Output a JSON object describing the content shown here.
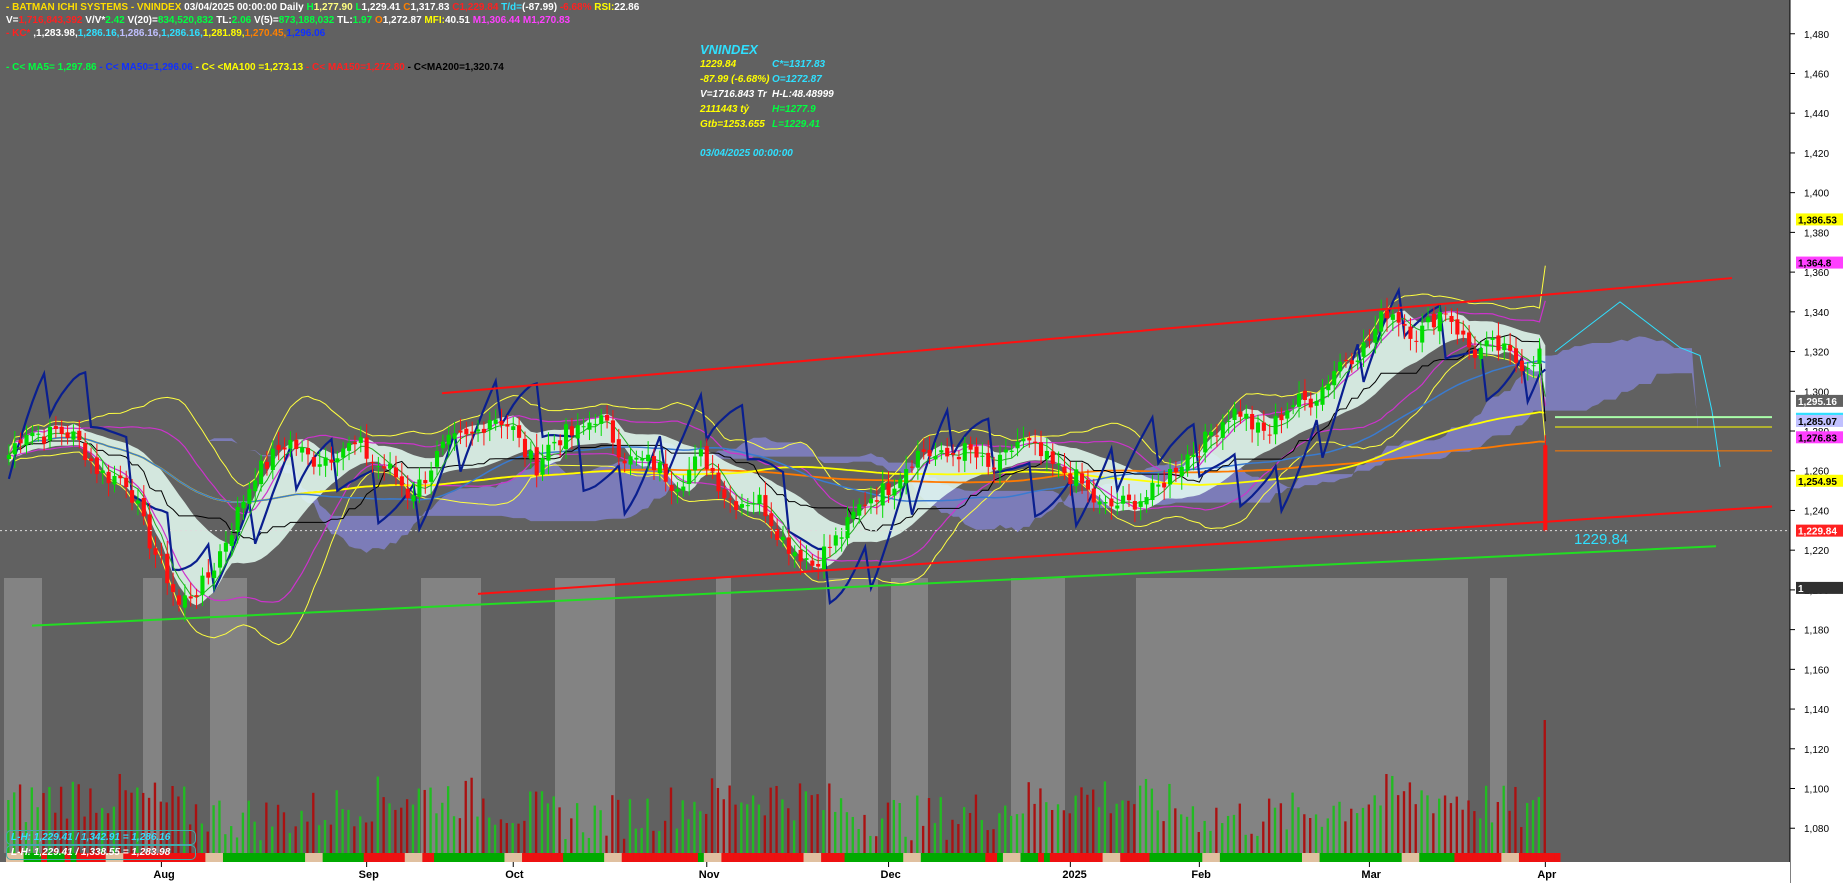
{
  "header": {
    "line1": [
      {
        "t": "- BATMAN  ICHI SYSTEMS - VNINDEX",
        "c": "#ffdd00"
      },
      {
        "t": " 03/04/2025 00:00:00  Daily ",
        "c": "#ffffff"
      },
      {
        "t": "H",
        "c": "#00ff40"
      },
      {
        "t": "1,277.90 ",
        "c": "#ffff80"
      },
      {
        "t": "L",
        "c": "#00ff40"
      },
      {
        "t": "1,229.41 ",
        "c": "#ffffff"
      },
      {
        "t": "C",
        "c": "#ff8000"
      },
      {
        "t": "1,317.83 ",
        "c": "#ffffff"
      },
      {
        "t": "C",
        "c": "#ff2020"
      },
      {
        "t": "1,229.84 ",
        "c": "#ff2020"
      },
      {
        "t": "T/d=",
        "c": "#2fe0ff"
      },
      {
        "t": "(-87.99) ",
        "c": "#ffffff"
      },
      {
        "t": "-6.68% ",
        "c": "#ff2020"
      },
      {
        "t": "RSI:",
        "c": "#ffff00"
      },
      {
        "t": "22.86",
        "c": "#ffffff"
      }
    ],
    "line2": [
      {
        "t": "V=",
        "c": "#ffffff"
      },
      {
        "t": "1,716,843,392 ",
        "c": "#ff2020"
      },
      {
        "t": "V/V*",
        "c": "#ffffff"
      },
      {
        "t": "2.42 ",
        "c": "#00ff40"
      },
      {
        "t": "V(20)=",
        "c": "#ffffff"
      },
      {
        "t": "834,520,832 ",
        "c": "#00ff40"
      },
      {
        "t": "TL:",
        "c": "#ffffff"
      },
      {
        "t": "2.06 ",
        "c": "#00ff40"
      },
      {
        "t": "V(5)=",
        "c": "#ffffff"
      },
      {
        "t": "873,188,032 ",
        "c": "#00ff40"
      },
      {
        "t": "TL:",
        "c": "#ffffff"
      },
      {
        "t": "1.97 ",
        "c": "#00ff40"
      },
      {
        "t": "O",
        "c": "#ff8000"
      },
      {
        "t": "1,272.87 ",
        "c": "#ffffff"
      },
      {
        "t": "MFI:",
        "c": "#ffff00"
      },
      {
        "t": "40.51 ",
        "c": "#ffffff"
      },
      {
        "t": "M",
        "c": "#ff40ff"
      },
      {
        "t": "1,306.44 ",
        "c": "#ff40ff"
      },
      {
        "t": "M",
        "c": "#ff40ff"
      },
      {
        "t": "1,270.83",
        "c": "#ff40ff"
      }
    ],
    "line3": [
      {
        "t": "- KC* ",
        "c": "#ff2020"
      },
      {
        "t": ",1,283.98,",
        "c": "#ffffff"
      },
      {
        "t": "1,286.16,",
        "c": "#2fe0ff"
      },
      {
        "t": "1,286.16,",
        "c": "#c0c0ff"
      },
      {
        "t": "1,286.16,",
        "c": "#2fe0ff"
      },
      {
        "t": "1,281.89,",
        "c": "#ffff00"
      },
      {
        "t": "1,270.45,",
        "c": "#ff8000"
      },
      {
        "t": "1,296.06",
        "c": "#1030ff"
      }
    ],
    "line4": [
      {
        "t": "- C< MA5= 1,297.86 ",
        "c": "#00ff40"
      },
      {
        "t": "- C< MA50=1,296.06 ",
        "c": "#1030ff"
      },
      {
        "t": "- C< <MA100 =1,273.13 ",
        "c": "#ffff00"
      },
      {
        "t": "- C< MA150=1,272.80 ",
        "c": "#ff2020"
      },
      {
        "t": "- C<MA200=1,320.74",
        "c": "#000000"
      }
    ]
  },
  "info": {
    "title": "VNINDEX",
    "rows": [
      [
        {
          "t": "1229.84",
          "c": "#ffff00"
        },
        {
          "t": "C*=1317.83",
          "c": "#2fe0ff"
        }
      ],
      [
        {
          "t": "-87.99 (-6.68%)",
          "c": "#ffff00"
        },
        {
          "t": "O=1272.87",
          "c": "#2fe0ff"
        }
      ],
      [
        {
          "t": "V=1716.843 Tr",
          "c": "#ffffff"
        },
        {
          "t": "H-L:48.48999",
          "c": "#ffffff"
        }
      ],
      [
        {
          "t": "2111443 tỷ",
          "c": "#ffff00"
        },
        {
          "t": "H=1277.9",
          "c": "#00ff40"
        }
      ],
      [
        {
          "t": "Gtb=1253.655",
          "c": "#ffff00"
        },
        {
          "t": "L=1229.41",
          "c": "#00ff40"
        }
      ]
    ],
    "date": "03/04/2025 00:00:00"
  },
  "legend_boxes": [
    {
      "t": "L-H: 1,229.41 / 1,342.91 = 1,286.16",
      "c": "#2fe0ff"
    },
    {
      "t": "L-H: 1,229.41 / 1,338.55 = 1,283.98",
      "c": "#ffffff"
    }
  ],
  "last_price_label": "1229.84",
  "chart_data": {
    "type": "candlestick",
    "title": "VNINDEX",
    "ylim": [
      1063,
      1497
    ],
    "y_ticks": [
      1080,
      1100,
      1120,
      1140,
      1160,
      1180,
      1200,
      1220,
      1240,
      1260,
      1280,
      1300,
      1320,
      1340,
      1360,
      1380,
      1400,
      1420,
      1440,
      1460,
      1480
    ],
    "x_tick_labels": [
      {
        "label": "Aug",
        "i": 26
      },
      {
        "label": "Sep",
        "i": 61
      },
      {
        "label": "Oct",
        "i": 86
      },
      {
        "label": "Nov",
        "i": 119
      },
      {
        "label": "Dec",
        "i": 150
      },
      {
        "label": "2025",
        "i": 181
      },
      {
        "label": "Feb",
        "i": 203
      },
      {
        "label": "Mar",
        "i": 232
      },
      {
        "label": "Apr",
        "i": 262
      }
    ],
    "n_bars": 265,
    "close_anchors": [
      [
        0,
        1268
      ],
      [
        3,
        1278
      ],
      [
        8,
        1282
      ],
      [
        14,
        1266
      ],
      [
        20,
        1252
      ],
      [
        26,
        1215
      ],
      [
        29,
        1189
      ],
      [
        33,
        1205
      ],
      [
        38,
        1228
      ],
      [
        42,
        1262
      ],
      [
        48,
        1272
      ],
      [
        55,
        1266
      ],
      [
        60,
        1275
      ],
      [
        63,
        1262
      ],
      [
        68,
        1250
      ],
      [
        72,
        1262
      ],
      [
        77,
        1277
      ],
      [
        82,
        1285
      ],
      [
        86,
        1282
      ],
      [
        90,
        1262
      ],
      [
        95,
        1280
      ],
      [
        100,
        1285
      ],
      [
        105,
        1270
      ],
      [
        110,
        1260
      ],
      [
        113,
        1256
      ],
      [
        118,
        1265
      ],
      [
        122,
        1250
      ],
      [
        128,
        1242
      ],
      [
        133,
        1225
      ],
      [
        137,
        1210
      ],
      [
        141,
        1228
      ],
      [
        146,
        1242
      ],
      [
        151,
        1258
      ],
      [
        156,
        1268
      ],
      [
        161,
        1270
      ],
      [
        167,
        1262
      ],
      [
        172,
        1272
      ],
      [
        177,
        1268
      ],
      [
        181,
        1255
      ],
      [
        186,
        1245
      ],
      [
        191,
        1240
      ],
      [
        195,
        1252
      ],
      [
        200,
        1262
      ],
      [
        205,
        1282
      ],
      [
        210,
        1288
      ],
      [
        215,
        1280
      ],
      [
        220,
        1295
      ],
      [
        225,
        1305
      ],
      [
        230,
        1322
      ],
      [
        235,
        1338
      ],
      [
        240,
        1332
      ],
      [
        245,
        1338
      ],
      [
        250,
        1322
      ],
      [
        255,
        1318
      ],
      [
        259,
        1317
      ],
      [
        261,
        1317.83
      ],
      [
        262,
        1229.84
      ]
    ],
    "ohlc_last": {
      "open": 1272.87,
      "high": 1277.9,
      "low": 1229.41,
      "close": 1229.84
    },
    "volume_last": 1716843392,
    "price_labels": [
      {
        "v": 1386.53,
        "label": "1,386.53",
        "bg": "#ffff00"
      },
      {
        "v": 1364.8,
        "label": "1,364.8",
        "bg": "#ff40ff"
      },
      {
        "v": 1295.16,
        "label": "1,295.16",
        "bg": "#616161",
        "fg": "#ffffff"
      },
      {
        "v": 1286.16,
        "label": "1,286.16",
        "bg": "#2fe0ff"
      },
      {
        "v": 1285.07,
        "label": "1,285.07",
        "bg": "#c0c0ff"
      },
      {
        "v": 1276.83,
        "label": "1,276.83",
        "bg": "#ff40ff"
      },
      {
        "v": 1254.95,
        "label": "1,254.95",
        "bg": "#ffff00"
      },
      {
        "v": 1229.84,
        "label": "1,229.84",
        "bg": "#ff2020",
        "fg": "#ffffff"
      },
      {
        "v": 1201,
        "label": "1",
        "bg": "#303030",
        "fg": "#ffffff"
      }
    ],
    "colors": {
      "up": "#00dd00",
      "down": "#ff1010",
      "ma50": "#1030ff",
      "ma200": "#000000",
      "cloud": "#8888dd",
      "band": "#ffff40",
      "channel": "#ff1010",
      "support": "#22dd22",
      "bg": "#616161",
      "shade": "#8a8a8a"
    }
  }
}
